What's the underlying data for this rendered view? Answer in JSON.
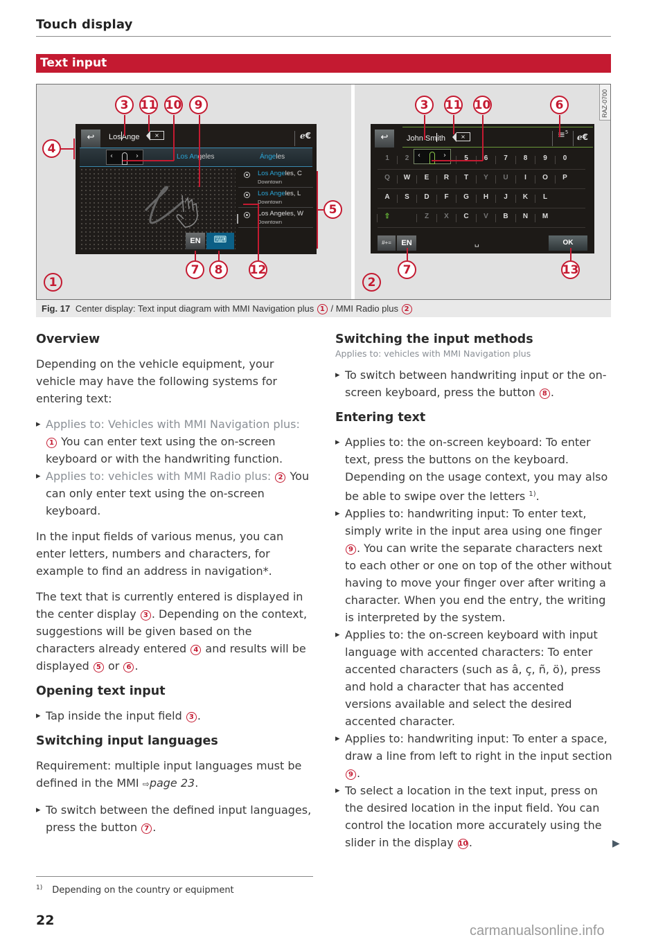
{
  "header": {
    "title": "Touch display"
  },
  "section": {
    "title": "Text input"
  },
  "figure": {
    "code": "RAZ-0700",
    "caption_label": "Fig. 17",
    "caption_text_a": "Center display: Text input diagram with MMI Navigation plus",
    "caption_sep": "/ MMI Radio plus",
    "callouts": {
      "c1": "1",
      "c2": "2",
      "c3": "3",
      "c4": "4",
      "c5": "5",
      "c6": "6",
      "c7": "7",
      "c8": "8",
      "c9": "9",
      "c10": "10",
      "c11": "11",
      "c12": "12",
      "c13": "13"
    },
    "nav_screen": {
      "back_icon": "↩",
      "input_before_caret": "Los",
      "input_after_caret": "Ange",
      "clear_icon": "×",
      "speller_icon": "ℯ€",
      "slider_left": "‹",
      "slider_right": "›",
      "suggestions": [
        {
          "highlight": "Los An",
          "rest": "geles"
        },
        {
          "highlight": "Ánge",
          "rest": "les"
        }
      ],
      "results": [
        {
          "highlight": "Los Ange",
          "rest": "les, C",
          "sub": "Downtown"
        },
        {
          "highlight": "Los Ange",
          "rest": "les, L",
          "sub": "Downtown"
        },
        {
          "highlight": "",
          "rest": "Los Angeles, W",
          "sub": "Downtown"
        }
      ],
      "lang_button": "EN",
      "keyboard_icon": "⌨"
    },
    "radio_screen": {
      "back_icon": "↩",
      "input_before_caret": "John Sm",
      "input_after_caret": "ith",
      "clear_icon": "×",
      "list_icon": "≡",
      "list_count": "5",
      "speller_icon": "ℯ€",
      "slider_left": "‹",
      "slider_right": "›",
      "rows": [
        [
          "1",
          "2",
          "3",
          "4",
          "5",
          "6",
          "7",
          "8",
          "9",
          "0"
        ],
        [
          "Q",
          "W",
          "E",
          "R",
          "T",
          "Y",
          "U",
          "I",
          "O",
          "P"
        ],
        [
          "A",
          "S",
          "D",
          "F",
          "G",
          "H",
          "J",
          "K",
          "L"
        ],
        [
          "⇧",
          "Z",
          "X",
          "C",
          "V",
          "B",
          "N",
          "M"
        ]
      ],
      "symbols_button": "#+=",
      "lang_button": "EN",
      "space_icon": "␣",
      "ok_button": "OK"
    }
  },
  "left_column": {
    "overview_heading": "Overview",
    "overview_intro": "Depending on the vehicle equipment, your vehicle may have the following systems for entering text:",
    "bullet1_applies": "Applies to: Vehicles with MMI Navigation plus:",
    "bullet1_callout": "1",
    "bullet1_text": "You can enter text using the on-screen keyboard or with the handwriting function.",
    "bullet2_applies": "Applies to: vehicles with MMI Radio plus:",
    "bullet2_callout": "2",
    "bullet2_text": "You can only enter text using the on-screen keyboard.",
    "para2": "In the input fields of various menus, you can enter letters, numbers and characters, for example to find an address in navigation*.",
    "para3_a": "The text that is currently entered is displayed in the center display",
    "para3_c3": "3",
    "para3_b": ". Depending on the context, suggestions will be given based on the characters already entered",
    "para3_c4": "4",
    "para3_c": "and results will be displayed",
    "para3_c5": "5",
    "para3_or": "or",
    "para3_c6": "6",
    "para3_end": ".",
    "opening_heading": "Opening text input",
    "opening_bullet": "Tap inside the input field",
    "opening_callout": "3",
    "switching_lang_heading": "Switching input languages",
    "requirement_text": "Requirement: multiple input languages must be defined in the MMI",
    "requirement_arrow": "⇨",
    "requirement_link": "page 23",
    "lang_bullet": "To switch between the defined input languages, press the button",
    "lang_callout": "7"
  },
  "right_column": {
    "methods_heading": "Switching the input methods",
    "methods_applies": "Applies to: vehicles with MMI Navigation plus",
    "methods_bullet": "To switch between handwriting input or the on-screen keyboard, press the button",
    "methods_callout": "8",
    "entering_heading": "Entering text",
    "b1": "Applies to: the on-screen keyboard: To enter text, press the buttons on the keyboard. Depending on the usage context, you may also be able to swipe over the letters",
    "b1_sup": "1)",
    "b2_a": "Applies to: handwriting input: To enter text, simply write in the input area using one finger",
    "b2_callout": "9",
    "b2_b": ". You can write the separate characters next to each other or one on top of the other without having to move your finger over after writing a character. When you end the entry, the writing is interpreted by the system.",
    "b3": "Applies to: the on-screen keyboard with input language with accented characters: To enter accented characters (such as â, ç, ñ, ö), press and hold a character that has accented versions available and select the desired accented character.",
    "b4": "Applies to: handwriting input: To enter a space, draw a line from left to right in the input section",
    "b4_callout": "9",
    "b5": "To select a location in the text input, press on the desired location in the input field. You can control the location more accurately using the slider in the display",
    "b5_callout": "10"
  },
  "footnote": {
    "mark": "1)",
    "text": "Depending on the country or equipment"
  },
  "page_number": "22",
  "continue_icon": "▶",
  "watermark": "carmanualsonline.info"
}
